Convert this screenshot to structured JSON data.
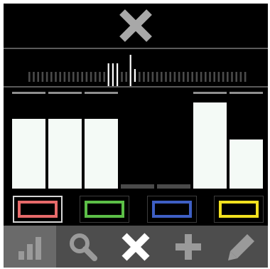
{
  "top": {
    "close_icon": "close-icon",
    "close_color": "#a8a8a8"
  },
  "track": {
    "tick_color": "#4a4a4a",
    "highlight_color": "#ffffff",
    "highlight_ticks": [
      18,
      19,
      20,
      23
    ]
  },
  "columns": {
    "bar_color": "#f4faf6",
    "rest_color": "#4a4a4a",
    "cap_color": "#8f8f8f",
    "levels": [
      0.75,
      0.75,
      0.75,
      0.0,
      0.0,
      0.93,
      0.53
    ]
  },
  "color_row": {
    "swatches": [
      {
        "name": "red-swatch",
        "color": "#e66a6a",
        "active": true
      },
      {
        "name": "green-swatch",
        "color": "#5cbf47",
        "active": false
      },
      {
        "name": "blue-swatch",
        "color": "#3e5fc4",
        "active": false
      },
      {
        "name": "yellow-swatch",
        "color": "#f2e11f",
        "active": false
      }
    ]
  },
  "toolbar": {
    "tools": [
      {
        "name": "chart-tool-button",
        "icon": "bar-chart-icon",
        "active": true
      },
      {
        "name": "search-tool-button",
        "icon": "search-icon",
        "active": false
      },
      {
        "name": "close-tool-button",
        "icon": "close-icon",
        "active": false
      },
      {
        "name": "add-tool-button",
        "icon": "plus-icon",
        "active": false
      },
      {
        "name": "edit-tool-button",
        "icon": "pencil-icon",
        "active": false
      }
    ],
    "icon_color": "#9a9a9a",
    "close_color": "#ffffff"
  }
}
